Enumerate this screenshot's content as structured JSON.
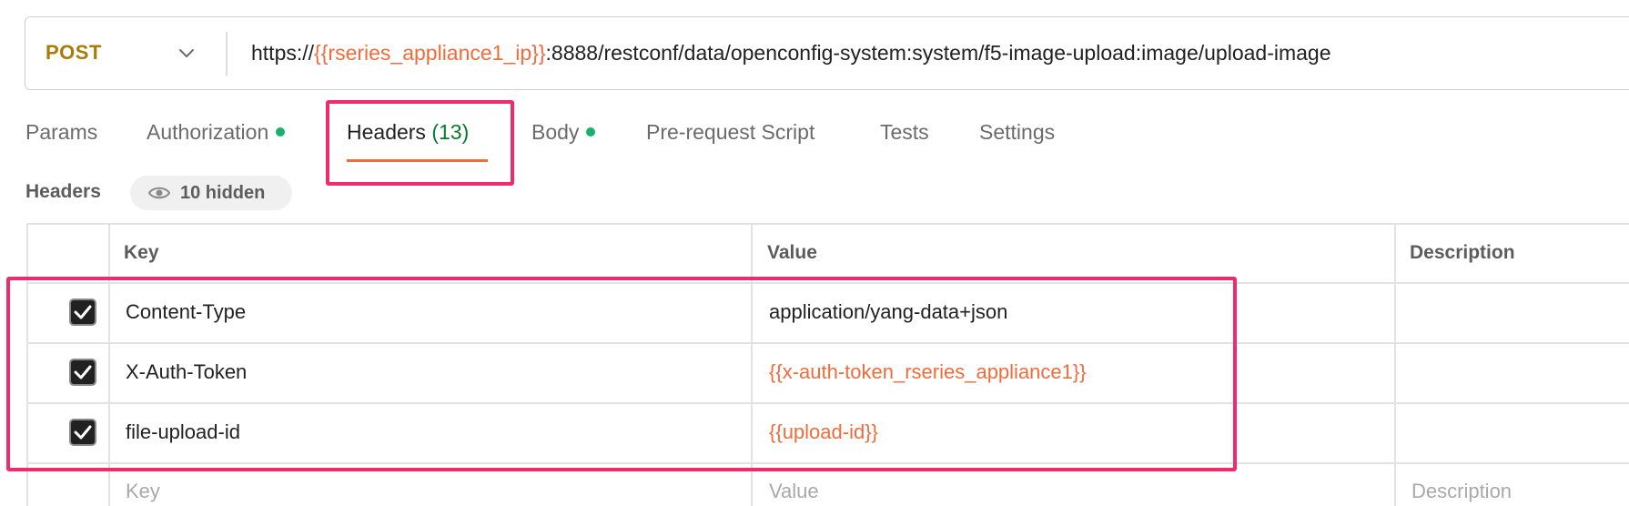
{
  "request": {
    "method": "POST",
    "url_parts": [
      {
        "text": "https://",
        "var": false
      },
      {
        "text": "{{rseries_appliance1_ip}}",
        "var": true
      },
      {
        "text": ":8888/restconf/data/openconfig-system:system/f5-image-upload:image/upload-image",
        "var": false
      }
    ]
  },
  "tabs": [
    {
      "label": "Params",
      "dot": false,
      "active": false
    },
    {
      "label": "Authorization",
      "dot": true,
      "active": false
    },
    {
      "label": "Headers",
      "count": "(13)",
      "dot": false,
      "active": true
    },
    {
      "label": "Body",
      "dot": true,
      "active": false
    },
    {
      "label": "Pre-request Script",
      "dot": false,
      "active": false
    },
    {
      "label": "Tests",
      "dot": false,
      "active": false
    },
    {
      "label": "Settings",
      "dot": false,
      "active": false
    }
  ],
  "headers_section": {
    "title": "Headers",
    "hidden_label": "10 hidden"
  },
  "table": {
    "columns": [
      "Key",
      "Value",
      "Description"
    ],
    "rows": [
      {
        "checked": true,
        "key": "Content-Type",
        "value": "application/yang-data+json",
        "value_is_var": false
      },
      {
        "checked": true,
        "key": "X-Auth-Token",
        "value": "{{x-auth-token_rseries_appliance1}}",
        "value_is_var": true
      },
      {
        "checked": true,
        "key": "file-upload-id",
        "value": "{{upload-id}}",
        "value_is_var": true
      }
    ],
    "placeholder": {
      "key": "Key",
      "value": "Value",
      "description": "Description"
    }
  },
  "colors": {
    "method": "#a87c0a",
    "variable": "#f26b3a",
    "active_underline": "#f26b3a",
    "dot": "#17b26a",
    "count": "#0a7a2a",
    "highlight": "#ee2b6b"
  },
  "icons": {
    "method_dropdown": "chevron-down-icon",
    "hidden": "eye-icon",
    "checkbox": "check-icon"
  }
}
